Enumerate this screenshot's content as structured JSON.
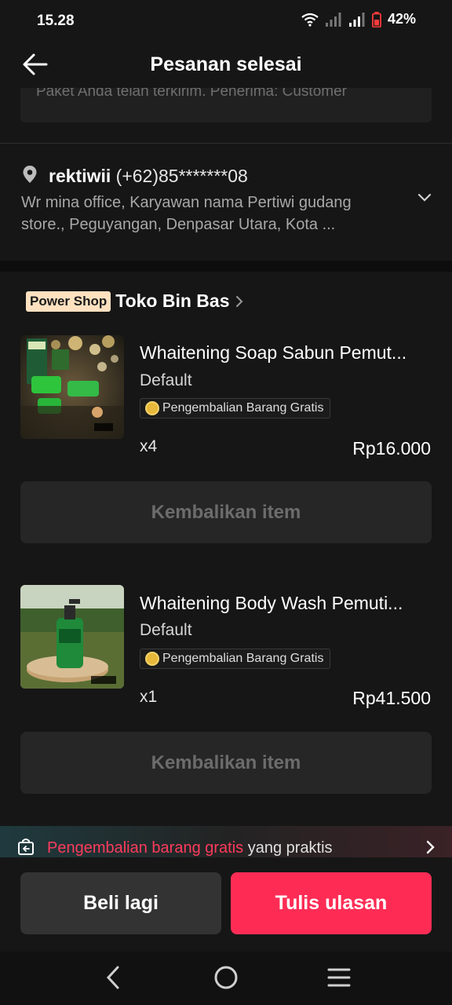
{
  "status_bar": {
    "time": "15.28",
    "battery": "42%"
  },
  "header": {
    "title": "Pesanan selesai"
  },
  "tracking": {
    "text": "Paket Anda telah terkirim. Penerima: Customer"
  },
  "address": {
    "name": "rektiwii",
    "phone": "(+62)85*******08",
    "line1": "Wr mina office, Karyawan nama Pertiwi gudang",
    "line2": "store., Peguyangan, Denpasar Utara, Kota ..."
  },
  "shop": {
    "badge": "Power Shop",
    "name": "Toko Bin Bas"
  },
  "products": [
    {
      "title": "Whaitening Soap Sabun Pemut...",
      "variant": "Default",
      "badge": "Pengembalian Barang Gratis",
      "qty": "x4",
      "price": "Rp16.000",
      "return_label": "Kembalikan item",
      "thumb_caption": "Toko attayeb"
    },
    {
      "title": "Whaitening Body Wash Pemuti...",
      "variant": "Default",
      "badge": "Pengembalian Barang Gratis",
      "qty": "x1",
      "price": "Rp41.500",
      "return_label": "Kembalikan item",
      "thumb_caption": "Toko attayeb"
    }
  ],
  "free_return": {
    "highlight": "Pengembalian barang gratis",
    "rest": " yang praktis"
  },
  "actions": {
    "buy_again": "Beli lagi",
    "write_review": "Tulis ulasan"
  },
  "colors": {
    "accent": "#fe2c55",
    "background": "#161616",
    "badge": "#ffe1c0"
  }
}
